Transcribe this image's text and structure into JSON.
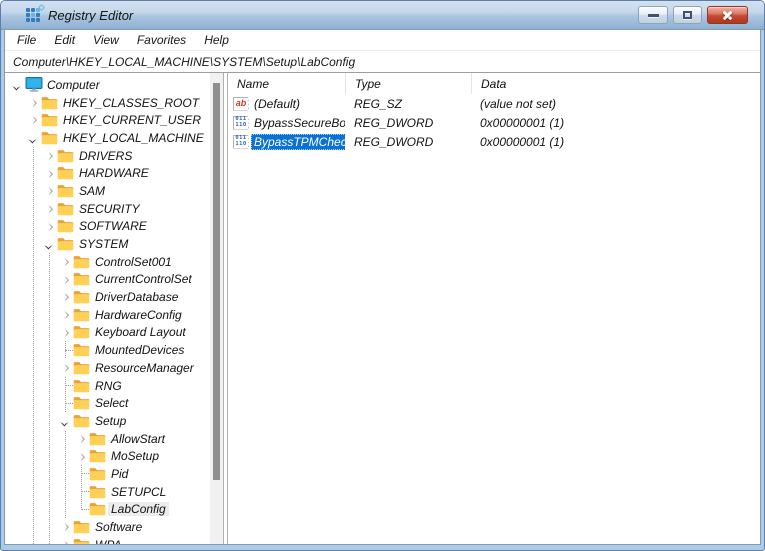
{
  "window": {
    "title": "Registry Editor"
  },
  "menu": {
    "items": [
      {
        "label": "File"
      },
      {
        "label": "Edit"
      },
      {
        "label": "View"
      },
      {
        "label": "Favorites"
      },
      {
        "label": "Help"
      }
    ]
  },
  "address": {
    "path": "Computer\\HKEY_LOCAL_MACHINE\\SYSTEM\\Setup\\LabConfig"
  },
  "tree": {
    "items": [
      {
        "label": "Computer",
        "level": 0,
        "expander": "expanded",
        "icon": "computer",
        "selected": false
      },
      {
        "label": "HKEY_CLASSES_ROOT",
        "level": 1,
        "expander": "collapsed",
        "icon": "folder",
        "selected": false
      },
      {
        "label": "HKEY_CURRENT_USER",
        "level": 1,
        "expander": "collapsed",
        "icon": "folder",
        "selected": false
      },
      {
        "label": "HKEY_LOCAL_MACHINE",
        "level": 1,
        "expander": "expanded",
        "icon": "folder",
        "selected": false
      },
      {
        "label": "DRIVERS",
        "level": 2,
        "expander": "collapsed",
        "icon": "folder",
        "selected": false
      },
      {
        "label": "HARDWARE",
        "level": 2,
        "expander": "collapsed",
        "icon": "folder",
        "selected": false
      },
      {
        "label": "SAM",
        "level": 2,
        "expander": "collapsed",
        "icon": "folder",
        "selected": false
      },
      {
        "label": "SECURITY",
        "level": 2,
        "expander": "collapsed",
        "icon": "folder",
        "selected": false
      },
      {
        "label": "SOFTWARE",
        "level": 2,
        "expander": "collapsed",
        "icon": "folder",
        "selected": false
      },
      {
        "label": "SYSTEM",
        "level": 2,
        "expander": "expanded",
        "icon": "folder",
        "selected": false
      },
      {
        "label": "ControlSet001",
        "level": 3,
        "expander": "collapsed",
        "icon": "folder",
        "selected": false
      },
      {
        "label": "CurrentControlSet",
        "level": 3,
        "expander": "collapsed",
        "icon": "folder",
        "selected": false
      },
      {
        "label": "DriverDatabase",
        "level": 3,
        "expander": "collapsed",
        "icon": "folder",
        "selected": false
      },
      {
        "label": "HardwareConfig",
        "level": 3,
        "expander": "collapsed",
        "icon": "folder",
        "selected": false
      },
      {
        "label": "Keyboard Layout",
        "level": 3,
        "expander": "collapsed",
        "icon": "folder",
        "selected": false
      },
      {
        "label": "MountedDevices",
        "level": 3,
        "expander": "none",
        "icon": "folder",
        "selected": false
      },
      {
        "label": "ResourceManager",
        "level": 3,
        "expander": "collapsed",
        "icon": "folder",
        "selected": false
      },
      {
        "label": "RNG",
        "level": 3,
        "expander": "none",
        "icon": "folder",
        "selected": false
      },
      {
        "label": "Select",
        "level": 3,
        "expander": "none",
        "icon": "folder",
        "selected": false
      },
      {
        "label": "Setup",
        "level": 3,
        "expander": "expanded",
        "icon": "folder",
        "selected": false
      },
      {
        "label": "AllowStart",
        "level": 4,
        "expander": "collapsed",
        "icon": "folder",
        "selected": false
      },
      {
        "label": "MoSetup",
        "level": 4,
        "expander": "collapsed",
        "icon": "folder",
        "selected": false
      },
      {
        "label": "Pid",
        "level": 4,
        "expander": "none",
        "icon": "folder",
        "selected": false
      },
      {
        "label": "SETUPCL",
        "level": 4,
        "expander": "none",
        "icon": "folder",
        "selected": false
      },
      {
        "label": "LabConfig",
        "level": 4,
        "expander": "none",
        "icon": "folder",
        "selected": true
      },
      {
        "label": "Software",
        "level": 3,
        "expander": "collapsed",
        "icon": "folder",
        "selected": false
      },
      {
        "label": "WPA",
        "level": 3,
        "expander": "collapsed",
        "icon": "folder",
        "selected": false
      }
    ]
  },
  "list": {
    "columns": [
      {
        "label": "Name"
      },
      {
        "label": "Type"
      },
      {
        "label": "Data"
      }
    ],
    "rows": [
      {
        "name": "(Default)",
        "type": "REG_SZ",
        "data": "(value not set)",
        "icon": "string-value",
        "selected": false
      },
      {
        "name": "BypassSecureBoot",
        "type": "REG_DWORD",
        "data": "0x00000001 (1)",
        "icon": "dword-value",
        "selected": false
      },
      {
        "name": "BypassTPMCheck",
        "type": "REG_DWORD",
        "data": "0x00000001 (1)",
        "icon": "dword-value",
        "selected": true
      }
    ]
  },
  "colors": {
    "selection_blue": "#0a72d3",
    "inactive_selection_gray": "#ececec",
    "titlebar_top": "#d3e2f1",
    "titlebar_bottom": "#8fb0d2",
    "close_button_red": "#c64b33",
    "folder_yellow": "#ffd056",
    "dword_icon_blue": "#2b5fc2",
    "string_icon_red": "#cf3a28"
  }
}
